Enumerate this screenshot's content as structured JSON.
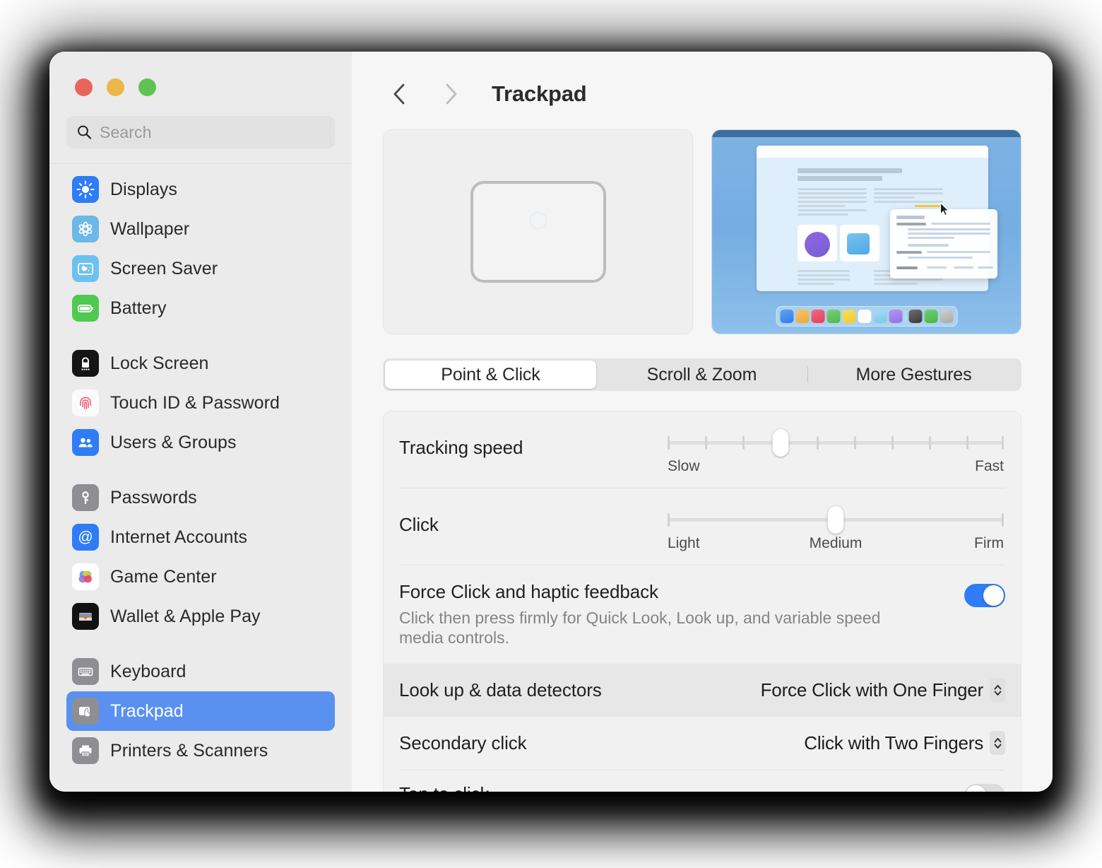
{
  "window": {
    "traffic_lights": [
      "close",
      "minimize",
      "zoom"
    ]
  },
  "sidebar": {
    "search": {
      "placeholder": "Search",
      "value": "",
      "icon": "search-icon"
    },
    "groups": [
      {
        "items": [
          {
            "label": "Displays",
            "icon": "displays-icon"
          },
          {
            "label": "Wallpaper",
            "icon": "wallpaper-icon"
          },
          {
            "label": "Screen Saver",
            "icon": "screen-saver-icon"
          },
          {
            "label": "Battery",
            "icon": "battery-icon"
          }
        ]
      },
      {
        "items": [
          {
            "label": "Lock Screen",
            "icon": "lock-screen-icon"
          },
          {
            "label": "Touch ID & Password",
            "icon": "touch-id-icon"
          },
          {
            "label": "Users & Groups",
            "icon": "users-groups-icon"
          }
        ]
      },
      {
        "items": [
          {
            "label": "Passwords",
            "icon": "passwords-icon"
          },
          {
            "label": "Internet Accounts",
            "icon": "internet-accounts-icon"
          },
          {
            "label": "Game Center",
            "icon": "game-center-icon"
          },
          {
            "label": "Wallet & Apple Pay",
            "icon": "wallet-icon"
          }
        ]
      },
      {
        "items": [
          {
            "label": "Keyboard",
            "icon": "keyboard-icon"
          },
          {
            "label": "Trackpad",
            "icon": "trackpad-icon",
            "selected": true
          },
          {
            "label": "Printers & Scanners",
            "icon": "printer-icon"
          }
        ]
      }
    ],
    "selection_color": "#5a91f0"
  },
  "header": {
    "back_label": "Back",
    "forward_label": "Forward",
    "title": "Trackpad"
  },
  "previews": {
    "trackpad_illustration": "trackpad-shape",
    "desktop_illustration": "desktop-preview",
    "dock_colors": [
      "#3f8ae0",
      "#eeb04a",
      "#e94f68",
      "#56be53",
      "#f4d33e",
      "#fbfbfb",
      "#88cdee",
      "#9b7ce8",
      "#4a4a4a",
      "#4fbd50",
      "#b9b9b9"
    ]
  },
  "tabs": [
    {
      "label": "Point & Click",
      "active": true
    },
    {
      "label": "Scroll & Zoom",
      "active": false
    },
    {
      "label": "More Gestures",
      "active": false
    }
  ],
  "settings": {
    "tracking_speed": {
      "label": "Tracking speed",
      "min_label": "Slow",
      "max_label": "Fast",
      "ticks": 10,
      "value_index": 3
    },
    "click": {
      "label": "Click",
      "min_label": "Light",
      "mid_label": "Medium",
      "max_label": "Firm",
      "value_percent": 50
    },
    "force_click": {
      "label": "Force Click and haptic feedback",
      "description": "Click then press firmly for Quick Look, Look up, and variable speed media controls.",
      "enabled": true,
      "on_color": "#2f7cf6"
    },
    "look_up": {
      "label": "Look up & data detectors",
      "value": "Force Click with One Finger",
      "hovered": true
    },
    "secondary_click": {
      "label": "Secondary click",
      "value": "Click with Two Fingers"
    },
    "tap_to_click": {
      "label": "Tap to click",
      "enabled": false
    }
  }
}
